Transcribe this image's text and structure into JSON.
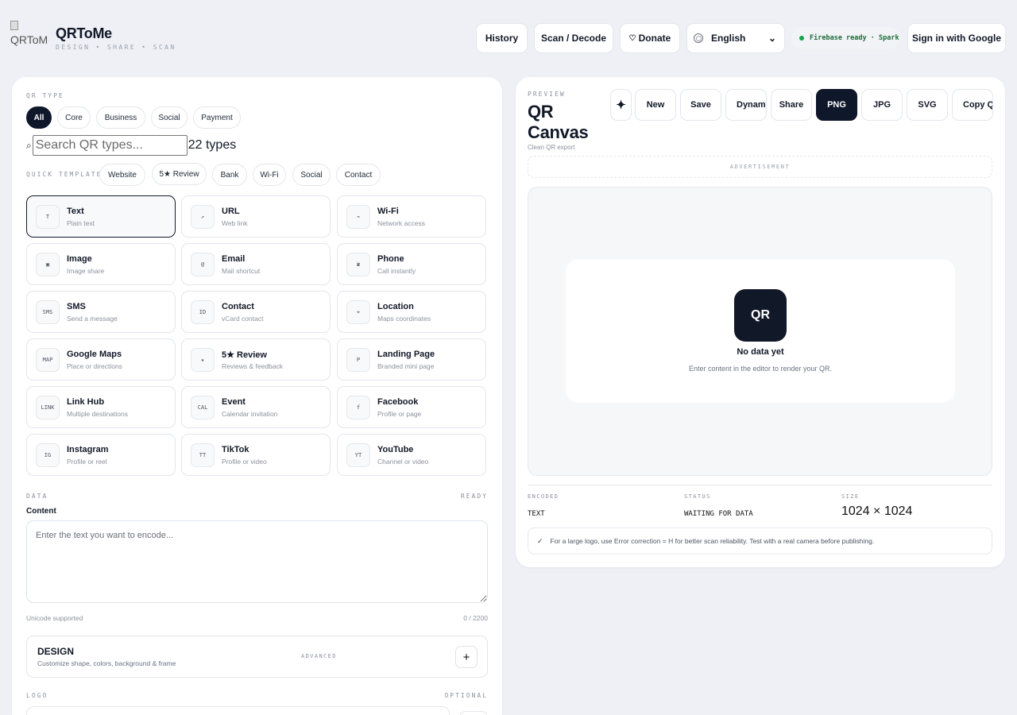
{
  "header": {
    "logo_alt": "QRToMe",
    "brand_name": "QRToMe",
    "tagline": "DESIGN • SHARE • SCAN",
    "nav": {
      "history": "History",
      "scan": "Scan / Decode",
      "donate_icon": "heart-icon",
      "donate": "Donate",
      "language": "English",
      "firebase_status": "Firebase ready · Spark",
      "sign_in": "Sign in with Google"
    }
  },
  "editor": {
    "qr_type_label": "QR TYPE",
    "filters": [
      "All",
      "Core",
      "Business",
      "Social",
      "Payment"
    ],
    "active_filter": "All",
    "search_placeholder": "Search QR types...",
    "type_count": "22 types",
    "quick_templates_label": "QUICK TEMPLATES",
    "templates": [
      "Website",
      "5★ Review",
      "Bank",
      "Wi-Fi",
      "Social",
      "Contact"
    ],
    "types": [
      {
        "icon": "T",
        "title": "Text",
        "subtitle": "Plain text",
        "selected": true
      },
      {
        "icon": "↗",
        "title": "URL",
        "subtitle": "Web link"
      },
      {
        "icon": "⌁",
        "title": "Wi-Fi",
        "subtitle": "Network access"
      },
      {
        "icon": "▣",
        "title": "Image",
        "subtitle": "Image share"
      },
      {
        "icon": "@",
        "title": "Email",
        "subtitle": "Mail shortcut"
      },
      {
        "icon": "☎",
        "title": "Phone",
        "subtitle": "Call instantly"
      },
      {
        "icon": "SMS",
        "title": "SMS",
        "subtitle": "Send a message"
      },
      {
        "icon": "ID",
        "title": "Contact",
        "subtitle": "vCard contact"
      },
      {
        "icon": "⌖",
        "title": "Location",
        "subtitle": "Maps coordinates"
      },
      {
        "icon": "MAP",
        "title": "Google Maps",
        "subtitle": "Place or directions"
      },
      {
        "icon": "★",
        "title": "5★ Review",
        "subtitle": "Reviews & feedback"
      },
      {
        "icon": "P",
        "title": "Landing Page",
        "subtitle": "Branded mini page"
      },
      {
        "icon": "LINK",
        "title": "Link Hub",
        "subtitle": "Multiple destinations"
      },
      {
        "icon": "CAL",
        "title": "Event",
        "subtitle": "Calendar invitation"
      },
      {
        "icon": "f",
        "title": "Facebook",
        "subtitle": "Profile or page"
      },
      {
        "icon": "IG",
        "title": "Instagram",
        "subtitle": "Profile or reel"
      },
      {
        "icon": "TT",
        "title": "TikTok",
        "subtitle": "Profile or video"
      },
      {
        "icon": "YT",
        "title": "YouTube",
        "subtitle": "Channel or video"
      }
    ],
    "data_label": "DATA",
    "data_status": "READY",
    "content_label": "Content",
    "content_placeholder": "Enter the text you want to encode...",
    "unicode_note": "Unicode supported",
    "char_count": "0 / 2200",
    "design_title": "DESIGN",
    "design_subtitle": "Customize shape, colors, background & frame",
    "design_tag": "ADVANCED",
    "expand_symbol": "+",
    "logo_label": "LOGO",
    "logo_tag": "OPTIONAL"
  },
  "preview": {
    "eyebrow": "PREVIEW",
    "title": "QR Canvas",
    "subtitle": "Clean QR export",
    "sparkle_icon": "sparkle-icon",
    "buttons": {
      "new": "New",
      "save": "Save",
      "dynamic": "Dynamic",
      "share": "Share",
      "png": "PNG",
      "jpg": "JPG",
      "svg": "SVG",
      "copy": "Copy QR"
    },
    "active_format": "PNG",
    "ad_label": "ADVERTISEMENT",
    "empty_badge": "QR",
    "empty_title": "No data yet",
    "empty_text": "Enter content in the editor to render your QR.",
    "stats": {
      "encoded_label": "ENCODED",
      "encoded_value": "TEXT",
      "status_label": "STATUS",
      "status_value": "WAITING FOR DATA",
      "size_label": "SIZE",
      "size_value": "1024 × 1024"
    },
    "tip": "For a large logo, use Error correction = H for better scan reliability. Test with a real camera before publishing."
  },
  "colors": {
    "background": "#eef0f5",
    "accent_dark": "#0f172a",
    "status_green": "#16a34a"
  }
}
